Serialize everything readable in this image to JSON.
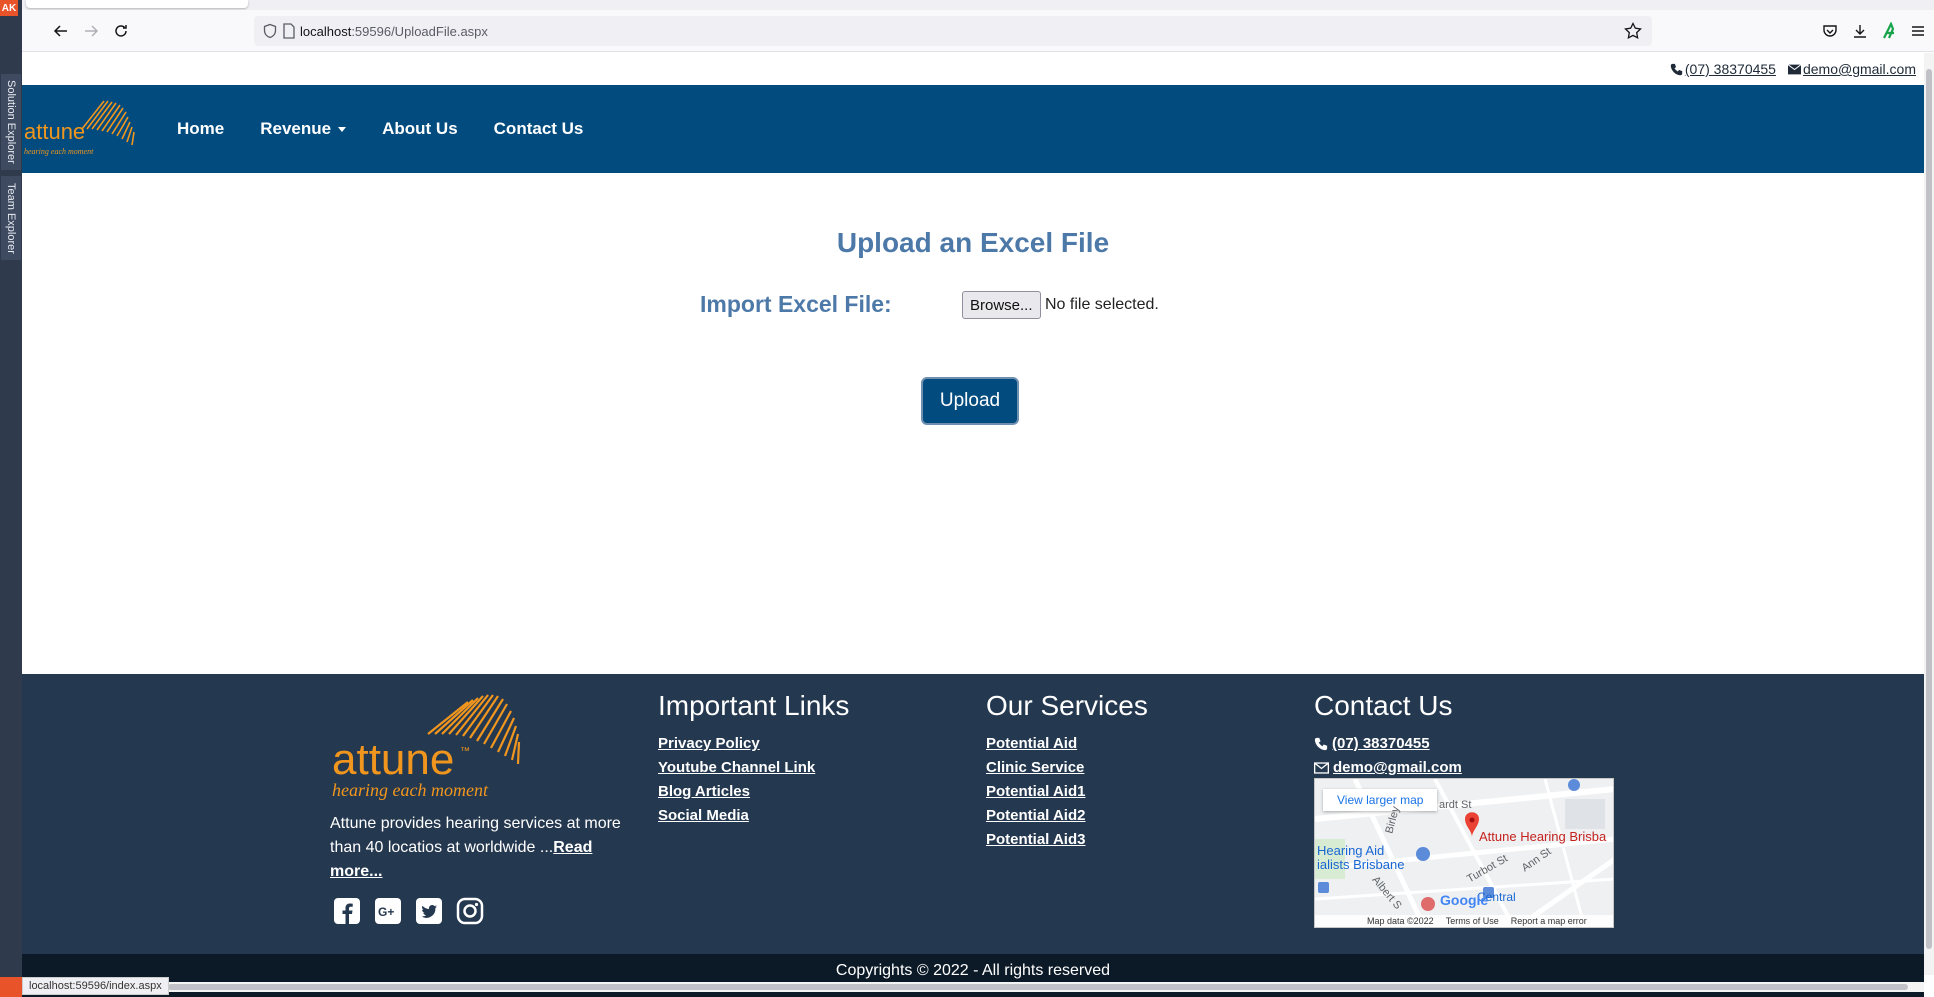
{
  "ide": {
    "badge": "AK",
    "tabs": [
      "Solution Explorer",
      "Team Explorer"
    ]
  },
  "browser": {
    "url_host": "localhost",
    "url_path": ":59596/UploadFile.aspx",
    "status_url": "localhost:59596/index.aspx"
  },
  "topbar": {
    "phone": "(07) 38370455",
    "email": "demo@gmail.com"
  },
  "brand": {
    "name": "attune",
    "tm": "™",
    "tagline": "hearing each moment"
  },
  "nav": {
    "items": [
      {
        "label": "Home"
      },
      {
        "label": "Revenue"
      },
      {
        "label": "About Us"
      },
      {
        "label": "Contact Us"
      }
    ]
  },
  "upload": {
    "title": "Upload an Excel File",
    "import_label": "Import Excel File:",
    "browse_label": "Browse...",
    "no_file": "No file selected.",
    "upload_label": "Upload"
  },
  "footer": {
    "about_text": "Attune provides hearing services at more than 40 locatios at worldwide ...",
    "read_more": "Read more...",
    "important_links": {
      "title": "Important Links",
      "links": [
        "Privacy Policy",
        "Youtube Channel Link",
        "Blog Articles",
        "Social Media"
      ]
    },
    "services": {
      "title": "Our Services",
      "links": [
        "Potential Aid",
        "Clinic Service",
        "Potential Aid1",
        "Potential Aid2",
        "Potential Aid3"
      ]
    },
    "contact": {
      "title": "Contact Us",
      "phone": "(07) 38370455",
      "email": "demo@gmail.com"
    },
    "map": {
      "larger_link": "View larger map",
      "business": "Attune Hearing Brisba",
      "hearing_line1": "Hearing Aid",
      "hearing_line2": "ialists Brisbane",
      "street1": "ardt St",
      "street2": "Turbot St",
      "street3": "Ann St",
      "street4": "Albert S",
      "street5": "Birley",
      "central": "Central",
      "google": "Google",
      "map_data": "Map data ©2022",
      "terms": "Terms of Use",
      "report": "Report a map error"
    },
    "copyright": "Copyrights © 2022 - All rights reserved"
  },
  "colors": {
    "navbar": "#014b7e",
    "footer": "#24384f",
    "copyright_bar": "#0c1a28",
    "heading": "#4d79a8",
    "brand_orange": "#f0961e"
  }
}
